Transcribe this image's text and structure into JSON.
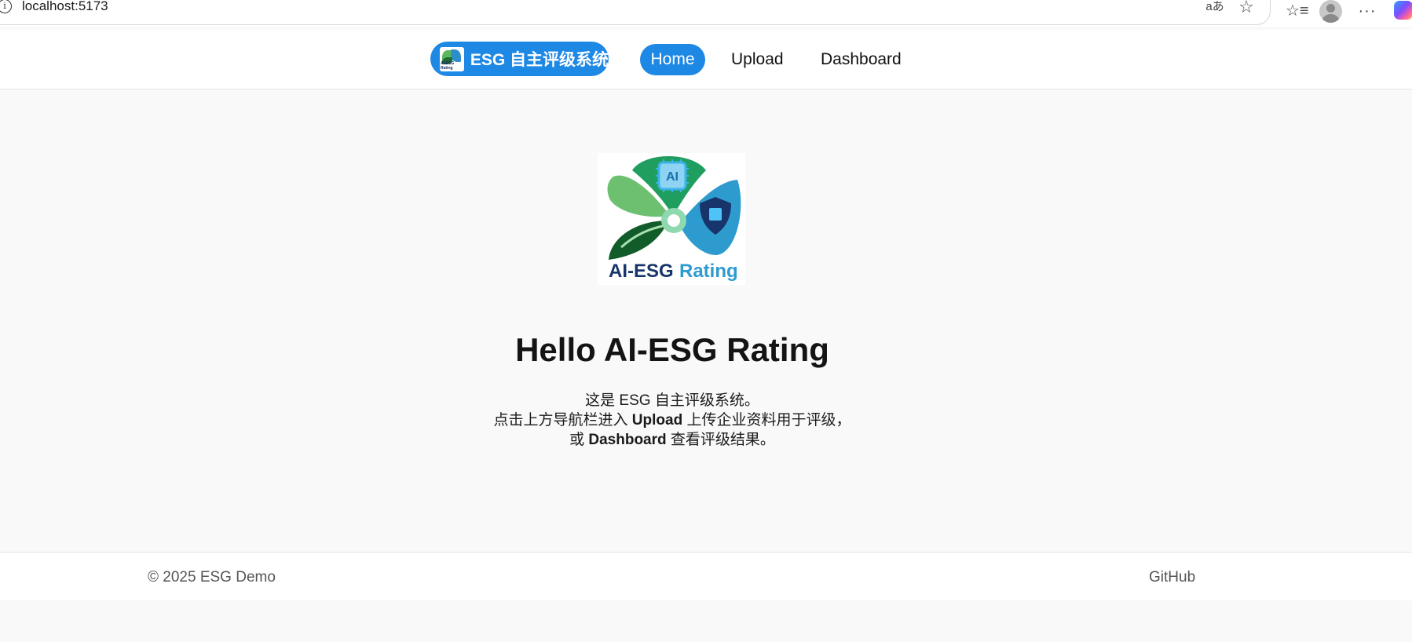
{
  "browser": {
    "url": "localhost:5173",
    "site_info_glyph": "i",
    "read_aloud_glyph": "aあ",
    "star_glyph": "☆",
    "favorites_glyph": "☆≡",
    "more_glyph": "···"
  },
  "header": {
    "brand_text": "ESG 自主评级系统",
    "brand_logo_text": "AI-ESG Rating",
    "nav": {
      "home": "Home",
      "upload": "Upload",
      "dashboard": "Dashboard"
    },
    "accent_color": "#1e88e5"
  },
  "hero": {
    "logo_text_dark": "AI-ESG",
    "logo_text_light": "Rating",
    "logo_chip_text": "AI",
    "title": "Hello AI-ESG Rating",
    "line1": "这是 ESG 自主评级系统。",
    "line2_pre": "点击上方导航栏进入 ",
    "line2_bold": "Upload",
    "line2_post": " 上传企业资料用于评级，",
    "line3_pre": "或 ",
    "line3_bold": "Dashboard",
    "line3_post": " 查看评级结果。"
  },
  "footer": {
    "copyright": "© 2025 ESG Demo",
    "github": "GitHub"
  }
}
